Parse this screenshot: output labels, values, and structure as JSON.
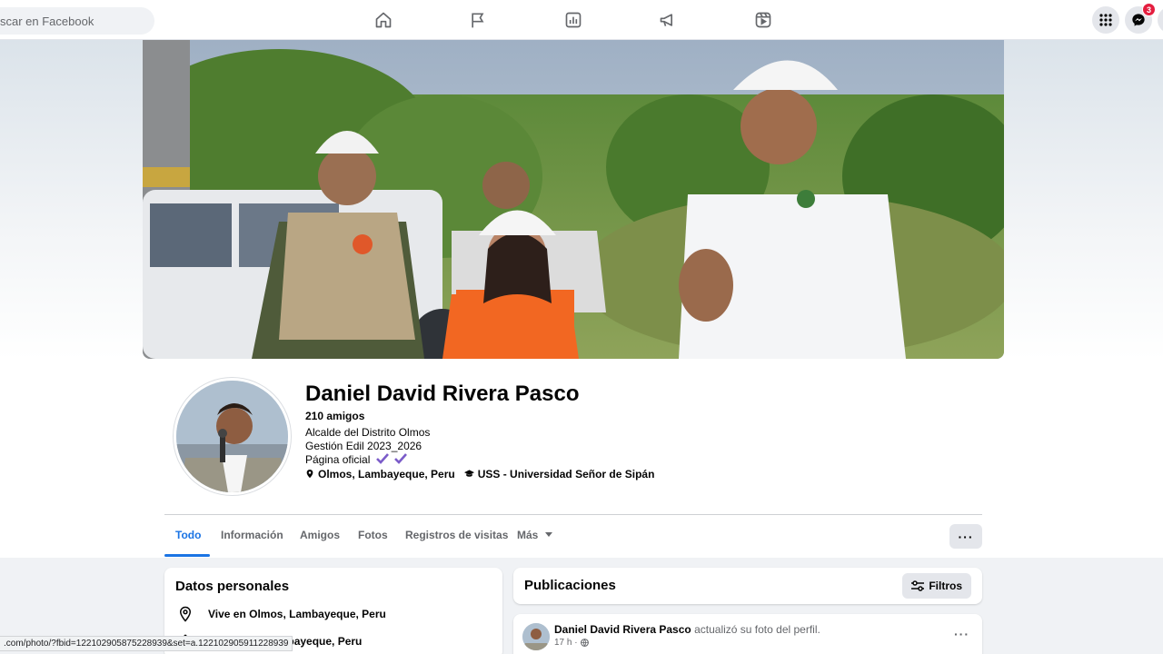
{
  "search": {
    "placeholder": "Buscar en Facebook",
    "visible_text": "scar en Facebook"
  },
  "nav": {
    "icons": [
      "home-icon",
      "flag-icon",
      "insights-icon",
      "megaphone-icon",
      "reels-icon"
    ],
    "right": {
      "menu": "apps-grid-icon",
      "messenger": "messenger-icon",
      "messenger_badge": "3"
    }
  },
  "profile": {
    "name": "Daniel David Rivera Pasco",
    "friends": "210 amigos",
    "bio": [
      "Alcalde del Distrito Olmos",
      "Gestión Edil 2023_2026",
      "Página oficial"
    ],
    "location": "Olmos, Lambayeque, Peru",
    "education": "USS - Universidad Señor de Sipán"
  },
  "tabs": [
    {
      "label": "Todo",
      "active": true
    },
    {
      "label": "Información"
    },
    {
      "label": "Amigos"
    },
    {
      "label": "Fotos"
    },
    {
      "label": "Registros de visitas"
    },
    {
      "label": "Más"
    }
  ],
  "more_button": "···",
  "personal": {
    "title": "Datos personales",
    "rows": [
      {
        "icon": "location-pin-icon",
        "text": "Vive en Olmos, Lambayeque, Peru"
      },
      {
        "icon": "home-icon",
        "text": "De Olmos, Lambayeque, Peru"
      }
    ]
  },
  "posts": {
    "title": "Publicaciones",
    "filter_label": "Filtros",
    "first": {
      "author": "Daniel David Rivera Pasco",
      "action": "actualizó su foto del perfil.",
      "time": "17 h ·"
    }
  },
  "status_url": ".com/photo/?fbid=122102905875228939&set=a.122102905911228939",
  "colors": {
    "accent": "#1b74e4",
    "badge": "#e41e3f",
    "verified": "#7b5cc9"
  }
}
